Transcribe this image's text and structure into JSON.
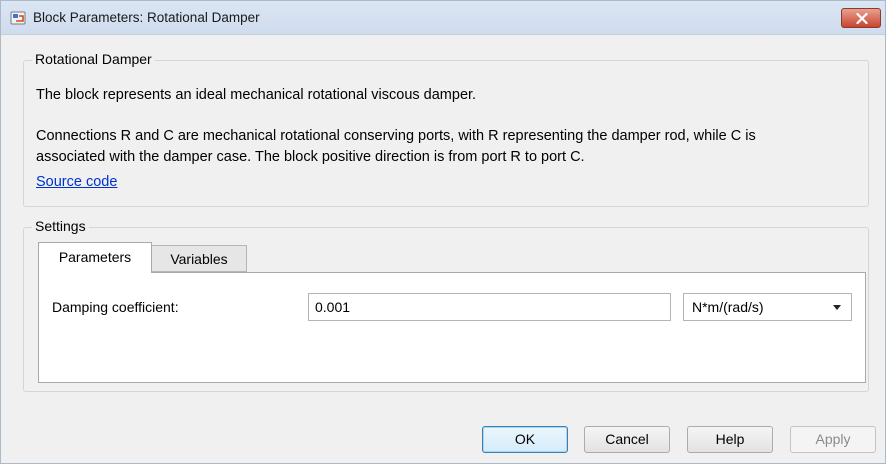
{
  "window": {
    "title": "Block Parameters: Rotational Damper"
  },
  "block": {
    "group_title": "Rotational Damper",
    "description_1": "The block represents an ideal mechanical rotational viscous damper.",
    "description_2_line1": "Connections R and C are mechanical rotational conserving ports, with R representing the damper rod, while C is",
    "description_2_line2": "associated with the damper case. The block positive direction is from port R to port C.",
    "source_link": "Source code"
  },
  "settings": {
    "group_title": "Settings",
    "tabs": [
      {
        "label": "Parameters",
        "active": true
      },
      {
        "label": "Variables",
        "active": false
      }
    ],
    "params": {
      "damping_label": "Damping coefficient:",
      "damping_value": "0.001",
      "damping_unit": "N*m/(rad/s)"
    }
  },
  "buttons": {
    "ok": "OK",
    "cancel": "Cancel",
    "help": "Help",
    "apply": "Apply"
  },
  "colors": {
    "link": "#0033cc",
    "close_button": "#c8452e"
  },
  "icons": {
    "app": "simulink-block-icon",
    "close": "close-icon",
    "dropdown": "chevron-down-icon"
  }
}
